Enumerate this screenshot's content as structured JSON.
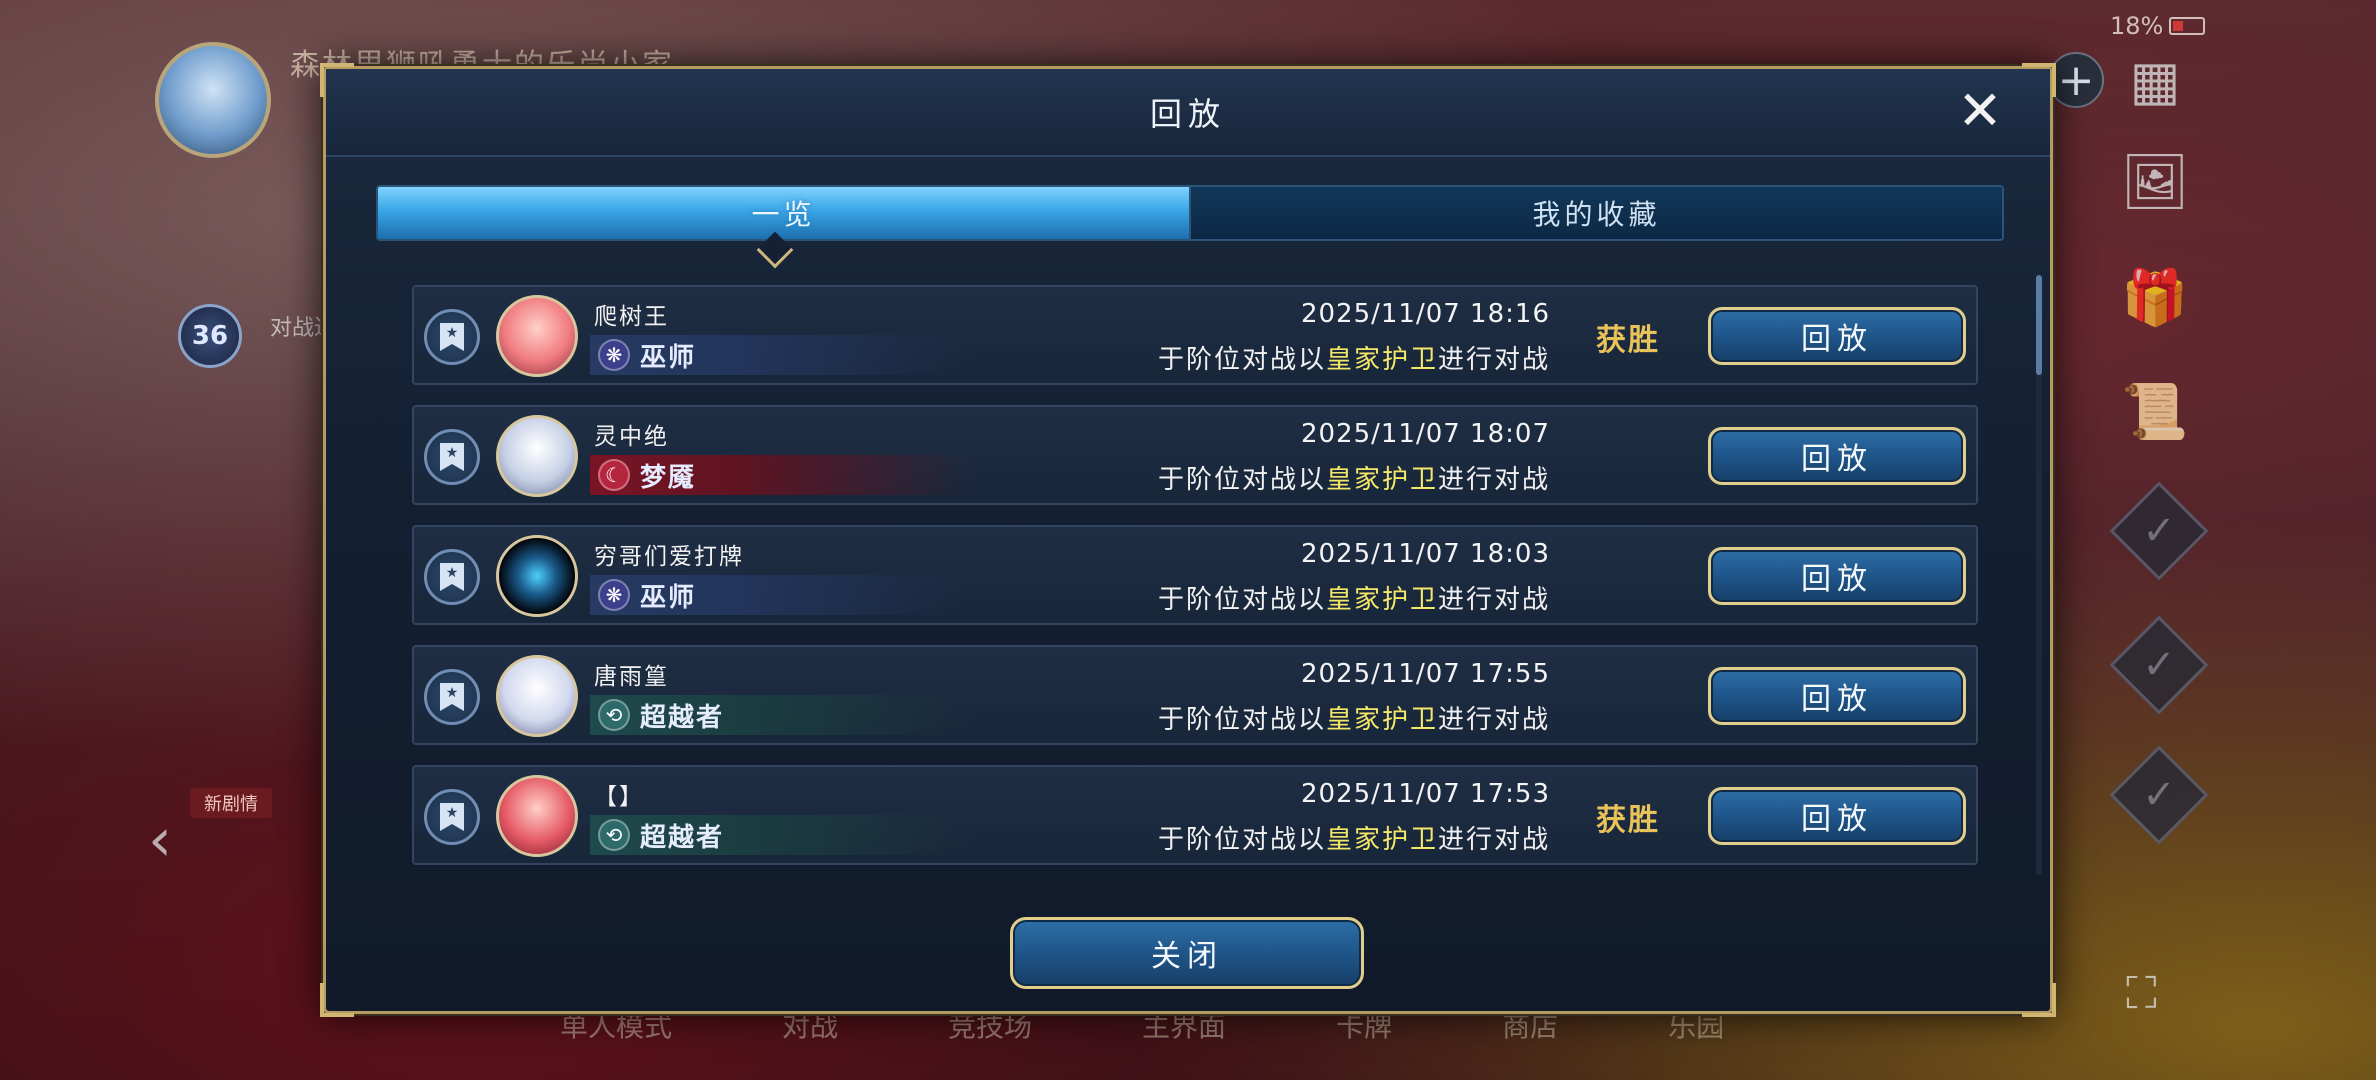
{
  "background": {
    "player_name": "森林里狮吼勇士的乐尚小家",
    "level": "36",
    "status_text": "对战进行中",
    "battery": "18%",
    "new_story_label": "新剧情",
    "bottom_nav": [
      "单人模式",
      "对战",
      "竞技场",
      "主界面",
      "卡牌",
      "商店",
      "乐园"
    ]
  },
  "modal": {
    "title": "回放",
    "tabs": [
      {
        "label": "一览",
        "active": true
      },
      {
        "label": "我的收藏",
        "active": false
      }
    ],
    "close_button_label": "关闭",
    "replay_button_label": "回放",
    "records": [
      {
        "player": "爬树王",
        "class": "巫师",
        "class_style": "wizard",
        "datetime": "2025/11/07  18:16",
        "desc_pre": "于阶位对战以",
        "deck": "皇家护卫",
        "desc_post": "进行对战",
        "result": "获胜"
      },
      {
        "player": "灵中绝",
        "class": "梦魇",
        "class_style": "nightmare",
        "datetime": "2025/11/07  18:07",
        "desc_pre": "于阶位对战以",
        "deck": "皇家护卫",
        "desc_post": "进行对战",
        "result": ""
      },
      {
        "player": "穷哥们爱打牌",
        "class": "巫师",
        "class_style": "wizard",
        "datetime": "2025/11/07  18:03",
        "desc_pre": "于阶位对战以",
        "deck": "皇家护卫",
        "desc_post": "进行对战",
        "result": ""
      },
      {
        "player": "唐雨篁",
        "class": "超越者",
        "class_style": "transcendent",
        "datetime": "2025/11/07  17:55",
        "desc_pre": "于阶位对战以",
        "deck": "皇家护卫",
        "desc_post": "进行对战",
        "result": ""
      },
      {
        "player": "【】",
        "class": "超越者",
        "class_style": "transcendent",
        "datetime": "2025/11/07  17:53",
        "desc_pre": "于阶位对战以",
        "deck": "皇家护卫",
        "desc_post": "进行对战",
        "result": "获胜"
      }
    ]
  },
  "colors": {
    "highlight": "#f4e86a",
    "win": "#e9c25a",
    "frame_gold": "#b59b62"
  }
}
